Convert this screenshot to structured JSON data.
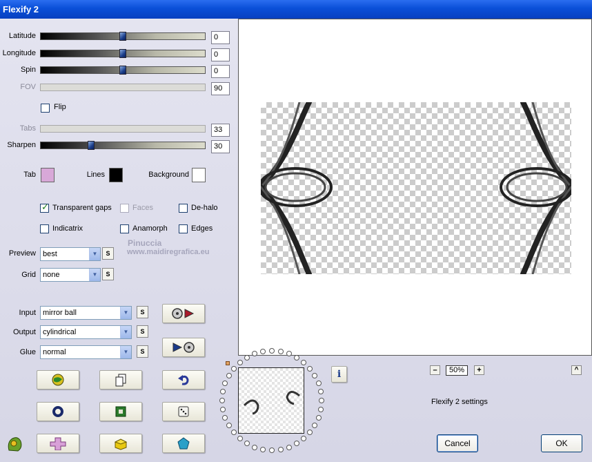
{
  "window": {
    "title": "Flexify 2"
  },
  "sliders": [
    {
      "label": "Latitude",
      "value": "0",
      "disabled": false,
      "level": 0.5
    },
    {
      "label": "Longitude",
      "value": "0",
      "disabled": false,
      "level": 0.5
    },
    {
      "label": "Spin",
      "value": "0",
      "disabled": false,
      "level": 0.5
    },
    {
      "label": "FOV",
      "value": "90",
      "disabled": true
    },
    {
      "label": "Tabs",
      "value": "33",
      "disabled": true
    },
    {
      "label": "Sharpen",
      "value": "30",
      "disabled": false,
      "level": 0.3
    }
  ],
  "flip": {
    "label": "Flip",
    "checked": false
  },
  "colors": {
    "tab": {
      "label": "Tab",
      "color": "#d8a8d8"
    },
    "lines": {
      "label": "Lines",
      "color": "#000000"
    },
    "background": {
      "label": "Background",
      "color": "#ffffff"
    }
  },
  "options": {
    "transparent_gaps": {
      "label": "Transparent gaps",
      "checked": true
    },
    "faces": {
      "label": "Faces",
      "checked": false,
      "disabled": true
    },
    "de_halo": {
      "label": "De-halo",
      "checked": false
    },
    "indicatrix": {
      "label": "Indicatrix",
      "checked": false
    },
    "anamorph": {
      "label": "Anamorph",
      "checked": false
    },
    "edges": {
      "label": "Edges",
      "checked": false
    }
  },
  "preview": {
    "label": "Preview",
    "value": "best"
  },
  "grid": {
    "label": "Grid",
    "value": "none"
  },
  "input": {
    "label": "Input",
    "value": "mirror ball"
  },
  "output": {
    "label": "Output",
    "value": "cylindrical"
  },
  "glue": {
    "label": "Glue",
    "value": "normal"
  },
  "s_button": "S",
  "zoom": {
    "minus": "–",
    "value": "50%",
    "plus": "+"
  },
  "settings_label": "Flexify 2 settings",
  "buttons": {
    "cancel": "Cancel",
    "ok": "OK"
  },
  "info_label": "i",
  "scroll_up": "^",
  "watermark": {
    "line1": "Pinuccia",
    "line2": "www.maidiregrafica.eu"
  }
}
